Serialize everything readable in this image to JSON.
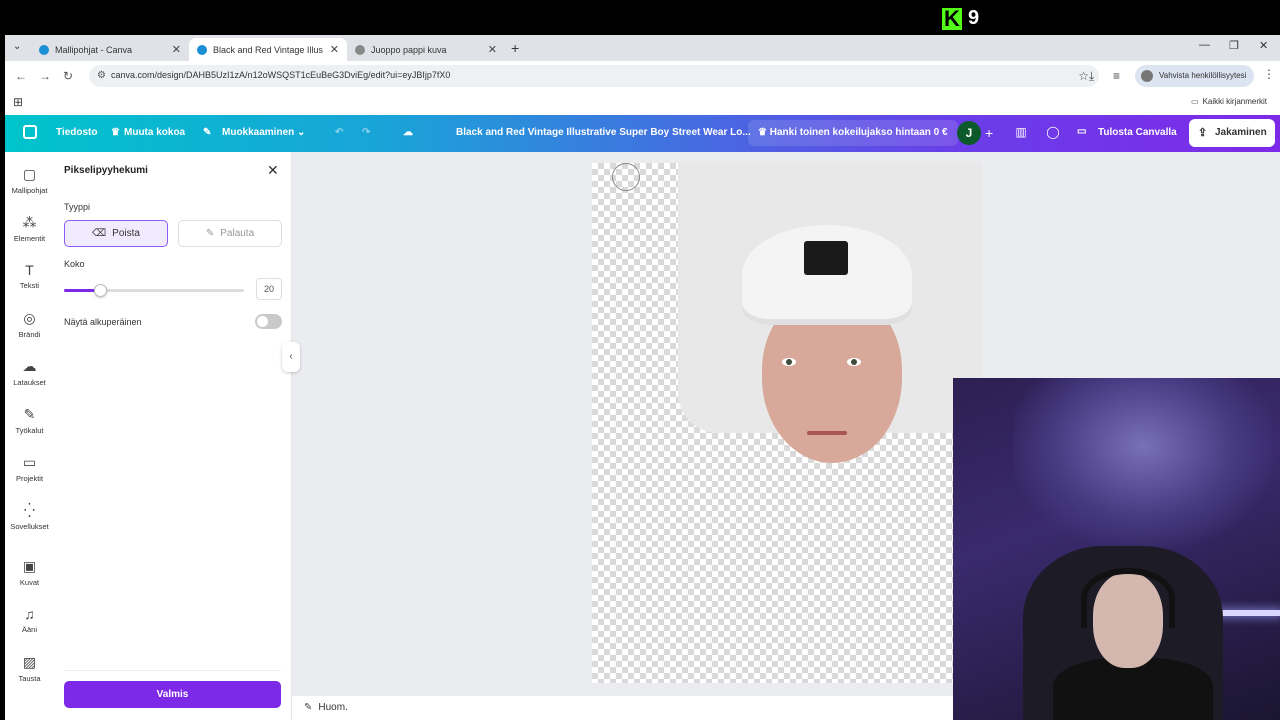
{
  "overlay": {
    "kick_count": "9"
  },
  "browser": {
    "tabs": [
      {
        "label": "Mallipohjat - Canva",
        "active": false
      },
      {
        "label": "Black and Red Vintage Illustrati",
        "active": true
      },
      {
        "label": "Juoppo pappi kuva",
        "active": false
      }
    ],
    "url": "canva.com/design/DAHB5UzI1zA/n12oWSQST1cEuBeG3DviEg/edit?ui=eyJBIjp7fX0",
    "verify_label": "Vahvista henkilöllisyytesi",
    "bookmarks_all": "Kaikki kirjanmerkit"
  },
  "canva_toolbar": {
    "file": "Tiedosto",
    "resize": "Muuta kokoa",
    "editing": "Muokkaaminen",
    "design_title": "Black and Red Vintage Illustrative Super Boy Street Wear Lo...",
    "trial": "Hanki toinen kokeilujakso hintaan 0 €",
    "avatar_initial": "J",
    "print": "Tulosta Canvalla",
    "share": "Jakaminen"
  },
  "left_rail": [
    {
      "label": "Mallipohjat",
      "icon": "templates-icon"
    },
    {
      "label": "Elementit",
      "icon": "elements-icon"
    },
    {
      "label": "Teksti",
      "icon": "text-icon"
    },
    {
      "label": "Brändi",
      "icon": "brand-icon"
    },
    {
      "label": "Lataukset",
      "icon": "uploads-icon"
    },
    {
      "label": "Työkalut",
      "icon": "tools-icon"
    },
    {
      "label": "Projektit",
      "icon": "projects-icon"
    },
    {
      "label": "Sovellukset",
      "icon": "apps-icon"
    },
    {
      "label": "Kuvat",
      "icon": "photos-icon"
    },
    {
      "label": "Ääni",
      "icon": "audio-icon"
    },
    {
      "label": "Tausta",
      "icon": "background-icon"
    }
  ],
  "eraser_panel": {
    "title": "Pikselipyyhekumi",
    "type_label": "Tyyppi",
    "erase_label": "Poista",
    "restore_label": "Palauta",
    "size_label": "Koko",
    "size_value": "20",
    "size_fraction": 0.2,
    "show_original_label": "Näytä alkuperäinen",
    "done_label": "Valmis"
  },
  "footer": {
    "notes_label": "Huom."
  }
}
